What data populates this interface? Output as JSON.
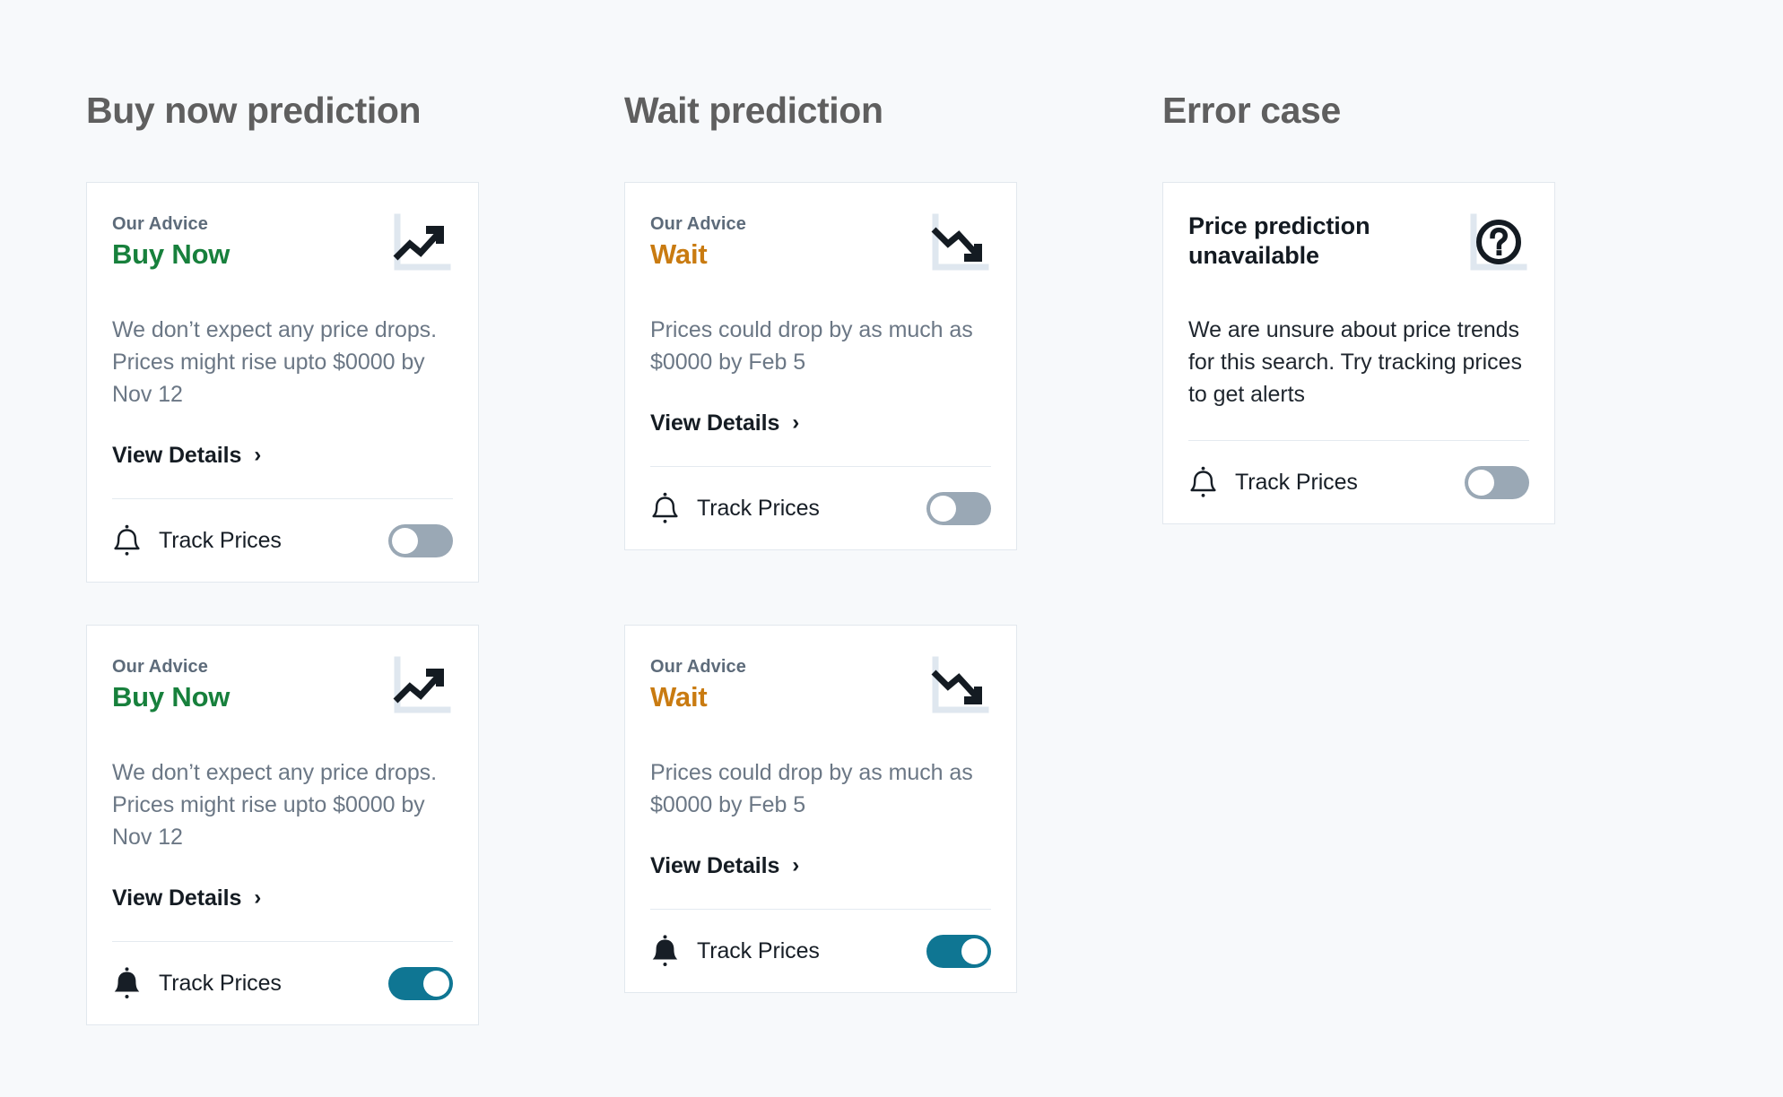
{
  "page": {
    "background_color": "#f7f9fb",
    "card_background": "#ffffff",
    "card_border_color": "#e2e8ee",
    "accent_buy_color": "#17803c",
    "accent_wait_color": "#c97b11",
    "toggle_on_color": "#0f7693",
    "toggle_off_color": "#9aa8b5",
    "body_text_color": "#6b7785"
  },
  "columns": [
    {
      "heading": "Buy now prediction"
    },
    {
      "heading": "Wait prediction"
    },
    {
      "heading": "Error case"
    }
  ],
  "cards": [
    {
      "id": "buy-now-toggle-off",
      "kind": "advice",
      "advice_label": "Our Advice",
      "advice_value": "Buy Now",
      "icon": "trending-up-icon",
      "body": "We don’t expect any price drops. Prices might rise upto $0000 by Nov 12",
      "view_details_label": "View Details",
      "chevron": "›",
      "track_label": "Track Prices",
      "track_icon": "bell-outline-icon",
      "track_enabled": false
    },
    {
      "id": "wait-toggle-off",
      "kind": "advice",
      "advice_label": "Our Advice",
      "advice_value": "Wait",
      "icon": "trending-down-icon",
      "body": "Prices could drop by as much as $0000 by Feb 5",
      "view_details_label": "View Details",
      "chevron": "›",
      "track_label": "Track Prices",
      "track_icon": "bell-outline-icon",
      "track_enabled": false
    },
    {
      "id": "error-unavailable",
      "kind": "error",
      "title": "Price prediction unavailable",
      "icon": "question-mark-circle-icon",
      "body": "We are unsure about price trends for this search. Try tracking prices to get alerts",
      "track_label": "Track Prices",
      "track_icon": "bell-outline-icon",
      "track_enabled": false
    },
    {
      "id": "buy-now-toggle-on",
      "kind": "advice",
      "advice_label": "Our Advice",
      "advice_value": "Buy Now",
      "icon": "trending-up-icon",
      "body": "We don’t expect any price drops. Prices might rise upto $0000 by Nov 12",
      "view_details_label": "View Details",
      "chevron": "›",
      "track_label": "Track Prices",
      "track_icon": "bell-filled-icon",
      "track_enabled": true
    },
    {
      "id": "wait-toggle-on",
      "kind": "advice",
      "advice_label": "Our Advice",
      "advice_value": "Wait",
      "icon": "trending-down-icon",
      "body": "Prices could drop by as much as $0000 by Feb 5",
      "view_details_label": "View Details",
      "chevron": "›",
      "track_label": "Track Prices",
      "track_icon": "bell-filled-icon",
      "track_enabled": true
    }
  ]
}
